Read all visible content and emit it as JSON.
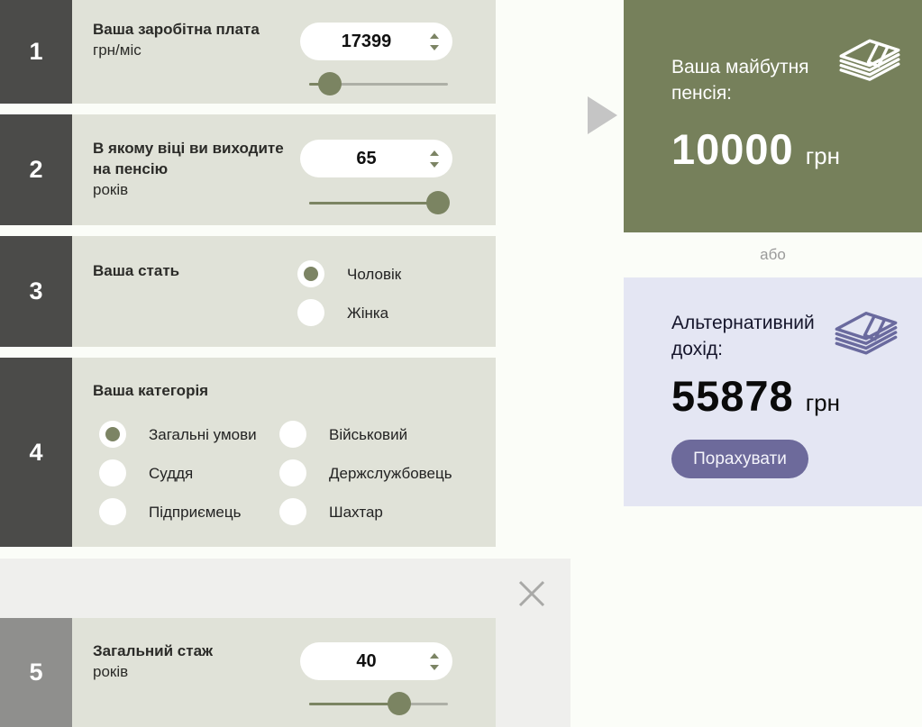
{
  "colors": {
    "accent_green": "#76805b",
    "accent_purple": "#6d6a9b",
    "panel_lavender": "#e4e6f3",
    "badge_dark": "#4b4b49",
    "badge_light": "#8f8f8d",
    "row_background": "#e0e2d8",
    "control_olive": "#7b8462",
    "overlay_gray": "#efefed"
  },
  "steps": [
    {
      "number": "1",
      "title": "Ваша заробітна плата",
      "unit": "грн/міс",
      "value": "17399",
      "slider_percent": 15
    },
    {
      "number": "2",
      "title": "В якому віці ви виходите на пенсію",
      "unit": "років",
      "value": "65",
      "slider_percent": 93
    },
    {
      "number": "3",
      "title": "Ваша стать",
      "options": [
        {
          "label": "Чоловік",
          "selected": true
        },
        {
          "label": "Жінка",
          "selected": false
        }
      ]
    },
    {
      "number": "4",
      "title": "Ваша категорія",
      "options": [
        {
          "label": "Загальні умови",
          "selected": true
        },
        {
          "label": "Військовий",
          "selected": false
        },
        {
          "label": "Суддя",
          "selected": false
        },
        {
          "label": "Держслужбовець",
          "selected": false
        },
        {
          "label": "Підприємець",
          "selected": false
        },
        {
          "label": "Шахтар",
          "selected": false
        }
      ]
    },
    {
      "number": "5",
      "title": "Загальний стаж",
      "unit": "років",
      "value": "40",
      "slider_percent": 65
    }
  ],
  "result": {
    "title": "Ваша майбутня пенсія:",
    "amount": "10000",
    "currency": "грн"
  },
  "divider": {
    "or_label": "або"
  },
  "alternative": {
    "title": "Альтернативний дохід:",
    "amount": "55878",
    "currency": "грн",
    "button_label": "Порахувати"
  },
  "icons": {
    "money": "money-stack-icon",
    "close": "close-icon",
    "arrow": "arrow-right-triangle-icon"
  }
}
